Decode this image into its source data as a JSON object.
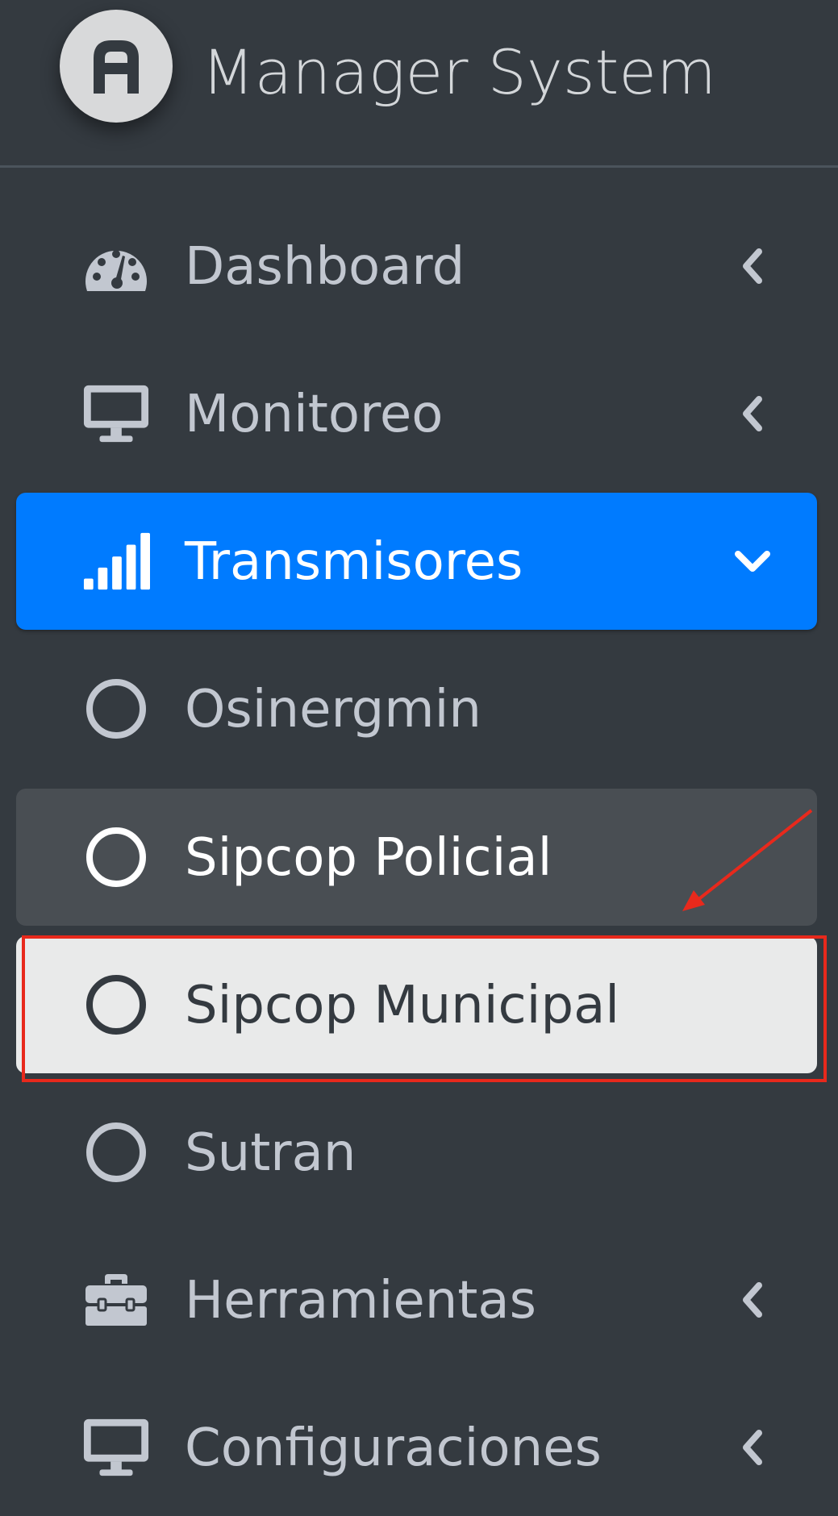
{
  "brand": {
    "name": "Manager System",
    "logo_icon": "letter-a-logo"
  },
  "sidebar": {
    "items": [
      {
        "label": "Dashboard",
        "icon": "tachometer-icon",
        "chevron": "chevron-left-icon",
        "state": "default"
      },
      {
        "label": "Monitoreo",
        "icon": "desktop-icon",
        "chevron": "chevron-left-icon",
        "state": "default"
      },
      {
        "label": "Transmisores",
        "icon": "signal-bars-icon",
        "chevron": "chevron-down-icon",
        "state": "active"
      },
      {
        "label": "Osinergmin",
        "icon": "circle-outline-icon",
        "state": "default"
      },
      {
        "label": "Sipcop Policial",
        "icon": "circle-outline-icon",
        "state": "hover"
      },
      {
        "label": "Sipcop Municipal",
        "icon": "circle-outline-icon",
        "state": "selected"
      },
      {
        "label": "Sutran",
        "icon": "circle-outline-icon",
        "state": "default"
      },
      {
        "label": "Herramientas",
        "icon": "toolbox-icon",
        "chevron": "chevron-left-icon",
        "state": "default"
      },
      {
        "label": "Configuraciones",
        "icon": "desktop-icon",
        "chevron": "chevron-left-icon",
        "state": "default"
      }
    ]
  },
  "colors": {
    "sidebar_bg": "#343a40",
    "active_bg": "#007bff",
    "hover_bg": "#494e53",
    "selected_bg": "#e9eaea",
    "text": "#c2c7d0",
    "annotation": "#e8291c"
  }
}
